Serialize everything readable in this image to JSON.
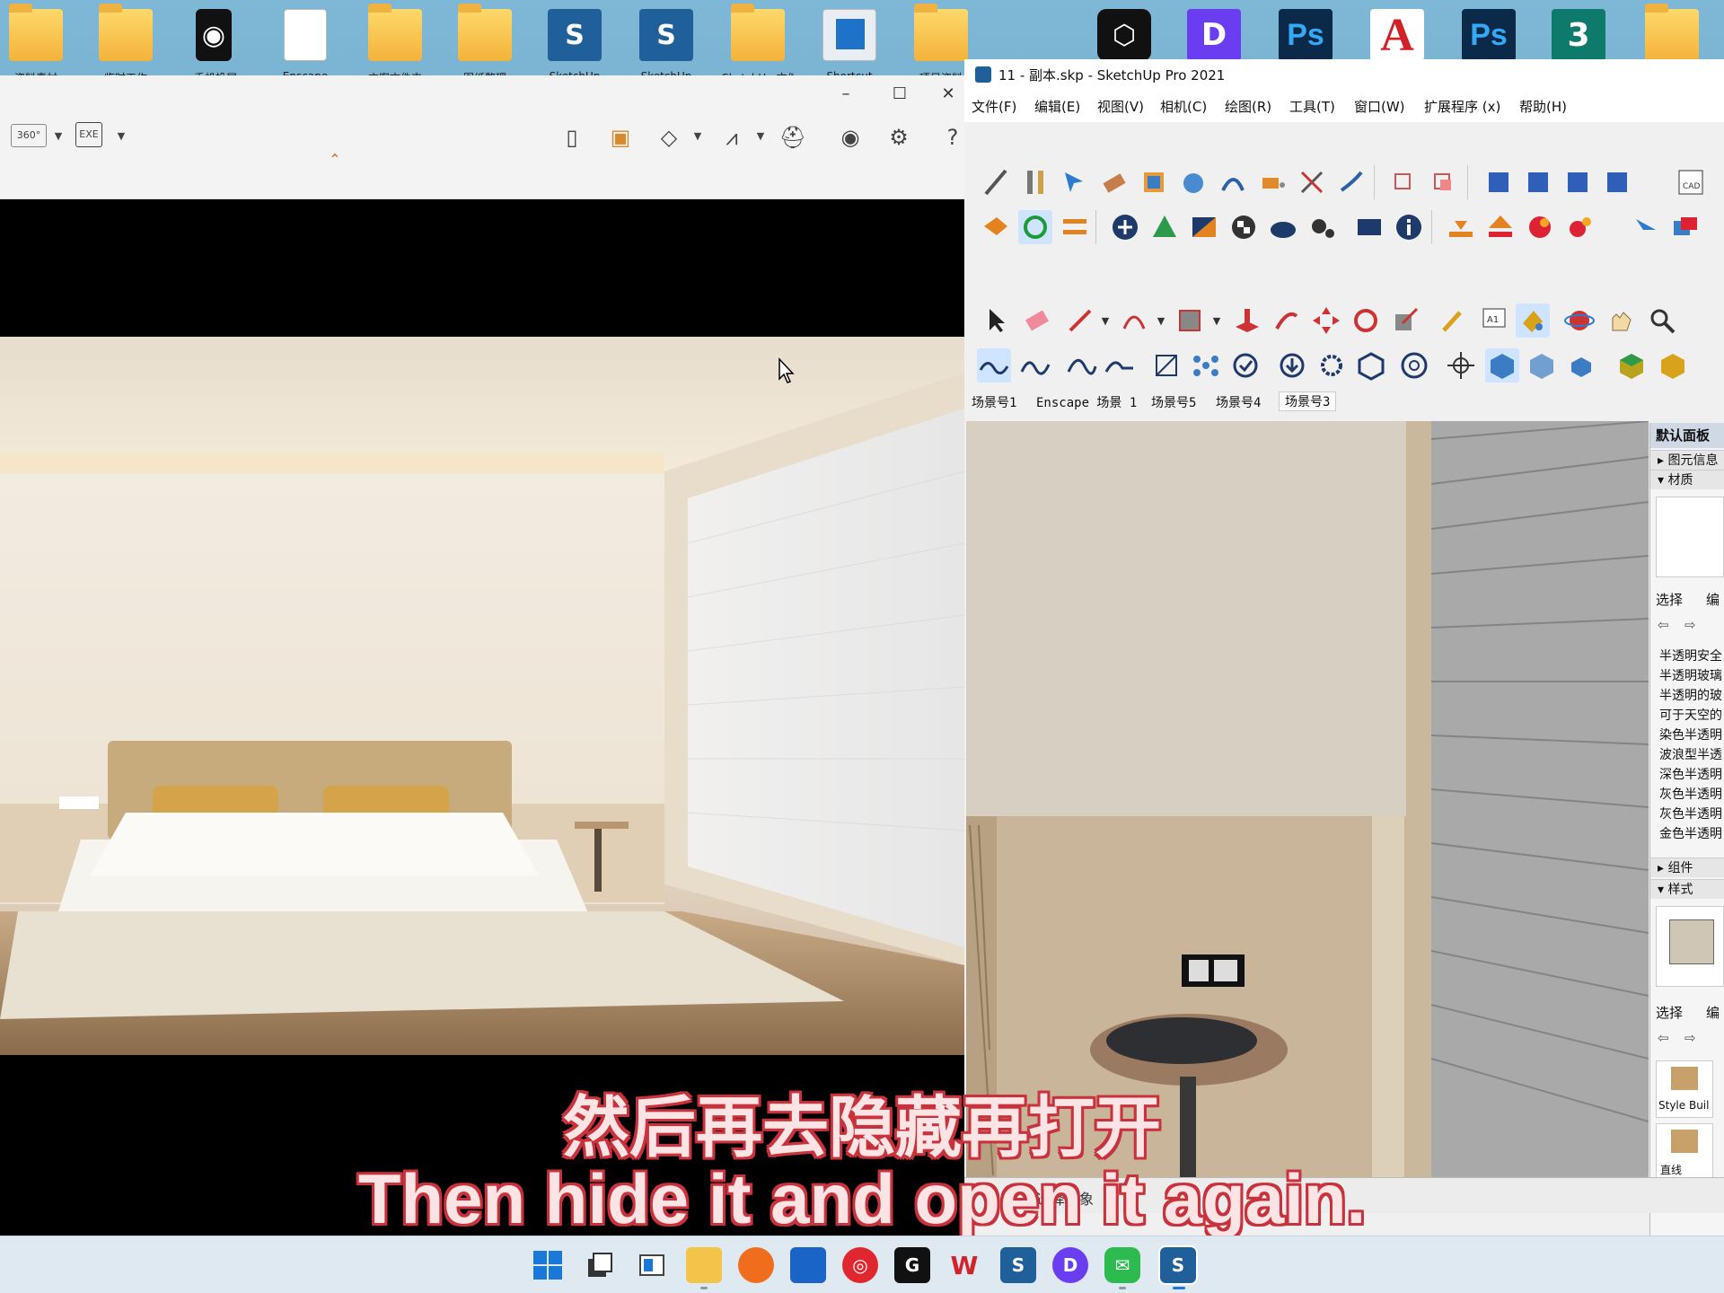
{
  "desktop": {
    "icons": [
      {
        "name": "folder-icon",
        "label": "资料素材"
      },
      {
        "name": "folder-icon",
        "label": "临时工作"
      },
      {
        "name": "phone-app-icon",
        "label": "手机投屏"
      },
      {
        "name": "file-shortcut-icon",
        "label": "Enscape"
      },
      {
        "name": "folder-icon",
        "label": "方案文件夹"
      },
      {
        "name": "folder-icon",
        "label": "图纸整理"
      },
      {
        "name": "sketchup-icon",
        "label": "SketchUp"
      },
      {
        "name": "sketchup-icon",
        "label": "SketchUp"
      },
      {
        "name": "folder-icon",
        "label": "SketchUp 文件"
      },
      {
        "name": "app-window-icon",
        "label": "Shortcut"
      },
      {
        "name": "folder-icon",
        "label": "项目资料"
      }
    ],
    "right_icons": [
      {
        "name": "d5-render-icon",
        "glyph": "⬡"
      },
      {
        "name": "d5-purple-icon",
        "glyph": "D"
      },
      {
        "name": "photoshop-icon",
        "glyph": "Ps"
      },
      {
        "name": "autocad-icon",
        "glyph": "A"
      },
      {
        "name": "photoshop-icon-2",
        "glyph": "Ps"
      },
      {
        "name": "3dsmax-icon",
        "glyph": "3"
      },
      {
        "name": "folder-icon",
        "glyph": ""
      }
    ]
  },
  "viewer": {
    "toolbar_icons": [
      "360-icon",
      "exe-export-icon",
      "map-icon",
      "image-icon",
      "cube-icon",
      "book-icon",
      "vr-headset-icon",
      "eye-icon",
      "gear-icon",
      "help-icon"
    ]
  },
  "sketchup": {
    "title": "11 - 副本.skp - SketchUp Pro 2021",
    "menus": [
      "文件(F)",
      "编辑(E)",
      "视图(V)",
      "相机(C)",
      "绘图(R)",
      "工具(T)",
      "窗口(W)",
      "扩展程序 (x)",
      "帮助(H)"
    ],
    "scene_tabs": [
      "场景号1",
      "Enscape 场景 1",
      "场景号5",
      "场景号4",
      "场景号3"
    ],
    "panel": {
      "title": "默认面板",
      "sec_entity": "图元信息",
      "sec_materials": "材质",
      "select_label": "选择",
      "edit_label": "编",
      "materials": [
        "半透明安全",
        "半透明玻璃",
        "半透明的玻",
        "可于天空的",
        "染色半透明",
        "波浪型半透",
        "深色半透明",
        "灰色半透明",
        "灰色半透明",
        "金色半透明"
      ],
      "sec_components": "组件",
      "sec_styles": "样式",
      "select_label_2": "选择",
      "edit_label_2": "编",
      "style_item": "Style Buil",
      "style_item_2": "直线"
    },
    "status_text": "选择对象"
  },
  "subtitles": {
    "zh": "然后再去隐藏再打开",
    "en": "Then hide it and open it again."
  },
  "taskbar": {
    "apps": [
      "start-icon",
      "task-view-icon",
      "widgets-icon",
      "file-explorer-icon",
      "firefox-icon",
      "store-icon",
      "netease-music-icon",
      "capcut-icon",
      "wps-icon",
      "sketchup-icon",
      "d5-render-icon",
      "wechat-icon",
      "sketchup-active-icon"
    ]
  }
}
